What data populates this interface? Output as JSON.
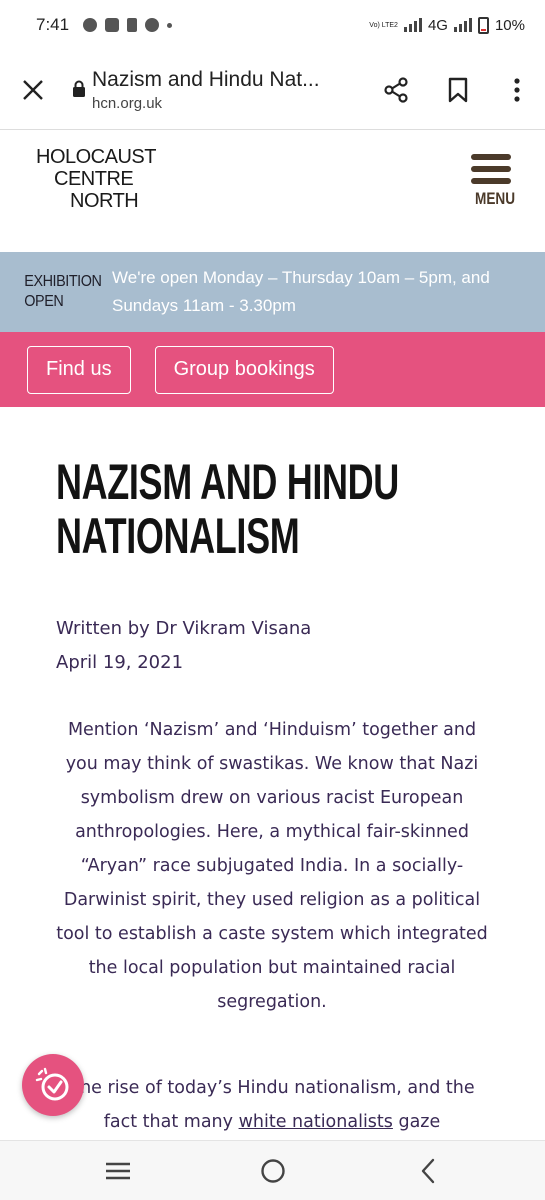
{
  "status_bar": {
    "time": "7:41",
    "network": "4G",
    "volte": "Vo) LTE2",
    "battery": "10%"
  },
  "browser": {
    "page_title": "Nazism and Hindu Nat...",
    "url": "hcn.org.uk"
  },
  "site": {
    "logo_lines": [
      "HOLOCAUST",
      "CENTRE",
      "NORTH"
    ],
    "menu_label": "MENU",
    "brand_pink": "#e5527f",
    "banner_blue": "#a8bdcf"
  },
  "exhibition": {
    "label_line1": "EXHIBITION",
    "label_line2": "OPEN",
    "hours": "We're open Monday – Thursday 10am – 5pm, and Sundays 11am - 3.30pm"
  },
  "actions": {
    "find_us": "Find us",
    "group_bookings": "Group bookings"
  },
  "article": {
    "title": "NAZISM AND HINDU NATIONALISM",
    "author": "Written by Dr Vikram Visana",
    "date": "April 19, 2021",
    "paragraph1": "Mention ‘Nazism’ and ‘Hinduism’ together and you may think of swastikas. We know that Nazi symbolism drew on various racist European anthropologies. Here, a mythical fair-skinned “Aryan” race subjugated India. In a socially-Darwinist spirit, they used religion as a political tool to establish a caste system which integrated the local population but maintained racial segregation.",
    "paragraph2_start": "The rise of today’s Hindu nationalism, and the fact that many ",
    "paragraph2_link": "white nationalists",
    "paragraph2_end": " gaze"
  }
}
